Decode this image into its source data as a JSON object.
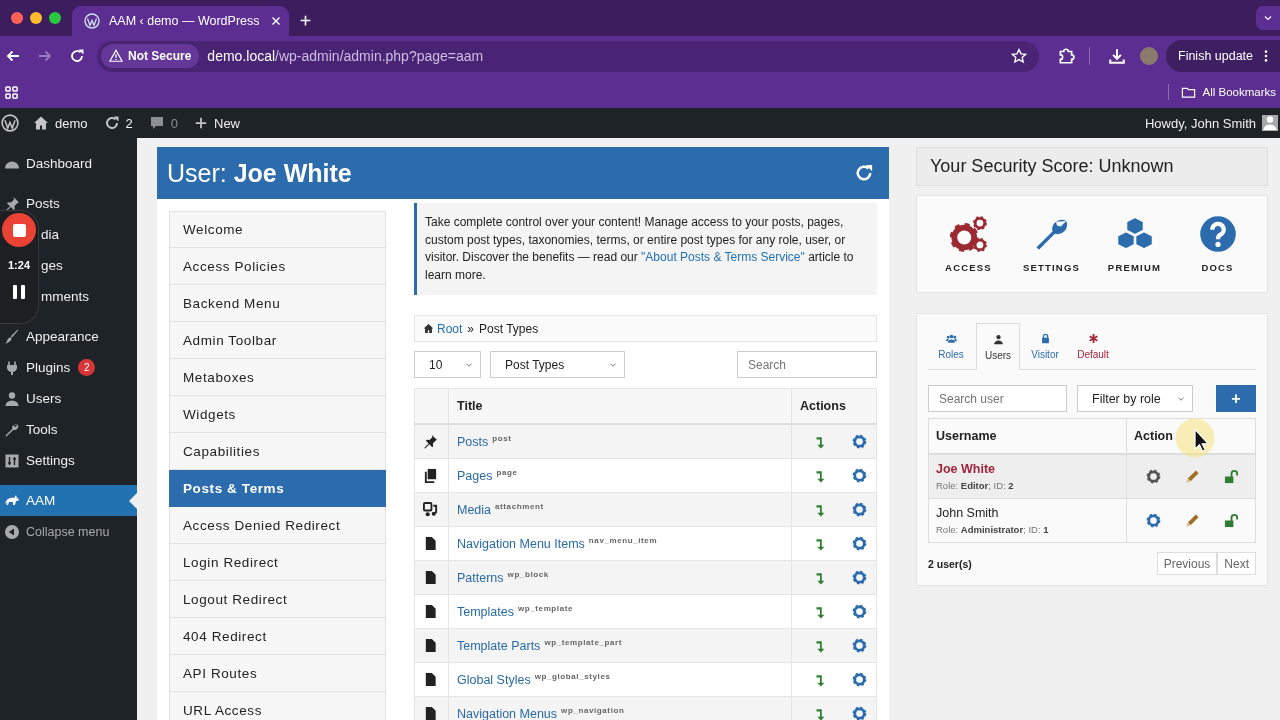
{
  "browser": {
    "tab_title": "AAM ‹ demo — WordPress",
    "security_label": "Not Secure",
    "url_host": "demo.local",
    "url_path": "/wp-admin/admin.php?page=aam",
    "update_button": "Finish update",
    "bookmarks_folder": "All Bookmarks"
  },
  "admin_bar": {
    "site_name": "demo",
    "updates_count": "2",
    "comments_count": "0",
    "new_label": "New",
    "greeting": "Howdy, John Smith"
  },
  "sidebar": {
    "groups": [
      [
        {
          "label": "Dashboard",
          "kind": "item",
          "selected": false
        }
      ],
      [
        {
          "label": "Posts",
          "kind": "item",
          "selected": false
        },
        {
          "label": "dia",
          "kind": "partial",
          "selected": false
        },
        {
          "label": "ges",
          "kind": "partial",
          "selected": false
        },
        {
          "label": "mments",
          "kind": "partial",
          "selected": false
        }
      ],
      [
        {
          "label": "Appearance",
          "kind": "item",
          "selected": false
        },
        {
          "label": "Plugins",
          "kind": "item",
          "badge": "2",
          "selected": false
        },
        {
          "label": "Users",
          "kind": "item",
          "selected": false
        },
        {
          "label": "Tools",
          "kind": "item",
          "selected": false
        },
        {
          "label": "Settings",
          "kind": "item",
          "selected": false
        }
      ],
      [
        {
          "label": "AAM",
          "kind": "item",
          "selected": true
        },
        {
          "label": "Collapse menu",
          "kind": "collapse",
          "selected": false
        }
      ]
    ]
  },
  "recorder": {
    "time": "1:24"
  },
  "panel": {
    "title": "User: **Joe White**",
    "nav": [
      {
        "label": "Welcome",
        "selected": false
      },
      {
        "label": "Access Policies",
        "selected": false
      },
      {
        "label": "Backend Menu",
        "selected": false
      },
      {
        "label": "Admin Toolbar",
        "selected": false
      },
      {
        "label": "Metaboxes",
        "selected": false
      },
      {
        "label": "Widgets",
        "selected": false
      },
      {
        "label": "Capabilities",
        "selected": false
      },
      {
        "label": "Posts & Terms",
        "selected": true
      },
      {
        "label": "Access Denied Redirect",
        "selected": false
      },
      {
        "label": "Login Redirect",
        "selected": false
      },
      {
        "label": "Logout Redirect",
        "selected": false
      },
      {
        "label": "404 Redirect",
        "selected": false
      },
      {
        "label": "API Routes",
        "selected": false
      },
      {
        "label": "URL Access",
        "selected": false
      }
    ],
    "notice": {
      "before": "Take complete control over your content! Manage access to your posts, pages, custom post types, taxonomies, terms, or entire post types for any role, user, or visitor. Discover the benefits — read our ",
      "link": "\"About Posts & Terms Service\"",
      "after": " article to learn more."
    },
    "breadcrumb": {
      "root": "Root",
      "separator": "»",
      "current": "Post Types"
    },
    "page_size": "10",
    "type_filter": "Post Types",
    "search_placeholder": "Search",
    "table": {
      "columns": [
        "Title",
        "Actions"
      ],
      "rows": [
        {
          "kind": "pin",
          "title": "Posts",
          "slug": "post"
        },
        {
          "kind": "pages",
          "title": "Pages",
          "slug": "page"
        },
        {
          "kind": "media",
          "title": "Media",
          "slug": "attachment"
        },
        {
          "kind": "file",
          "title": "Navigation Menu Items",
          "slug": "nav_menu_item"
        },
        {
          "kind": "file",
          "title": "Patterns",
          "slug": "wp_block"
        },
        {
          "kind": "file",
          "title": "Templates",
          "slug": "wp_template"
        },
        {
          "kind": "file",
          "title": "Template Parts",
          "slug": "wp_template_part"
        },
        {
          "kind": "file",
          "title": "Global Styles",
          "slug": "wp_global_styles"
        },
        {
          "kind": "file",
          "title": "Navigation Menus",
          "slug": "wp_navigation"
        }
      ]
    }
  },
  "security": {
    "title": "Your Security Score: Unknown"
  },
  "shortcuts": [
    {
      "kind": "access",
      "label": "ACCESS"
    },
    {
      "kind": "settings",
      "label": "SETTINGS"
    },
    {
      "kind": "premium",
      "label": "PREMIUM"
    },
    {
      "kind": "docs",
      "label": "DOCS"
    }
  ],
  "subjects": {
    "tabs": [
      {
        "kind": "roles",
        "label": "Roles",
        "selected": false
      },
      {
        "kind": "users",
        "label": "Users",
        "selected": true
      },
      {
        "kind": "visitor",
        "label": "Visitor",
        "selected": false
      },
      {
        "kind": "default",
        "label": "Default",
        "selected": false
      }
    ],
    "search_placeholder": "Search user",
    "role_filter": "Filter by role",
    "add_button": "+",
    "columns": [
      "Username",
      "Action"
    ],
    "rows": [
      {
        "name": "Joe White",
        "details": "Role: **Editor**; ID: **2**",
        "selected": true
      },
      {
        "name": "John Smith",
        "details": "Role: **Administrator**; ID: **1**",
        "selected": false
      }
    ],
    "count": "2 user(s)",
    "pagination": [
      "Previous",
      "Next"
    ]
  }
}
